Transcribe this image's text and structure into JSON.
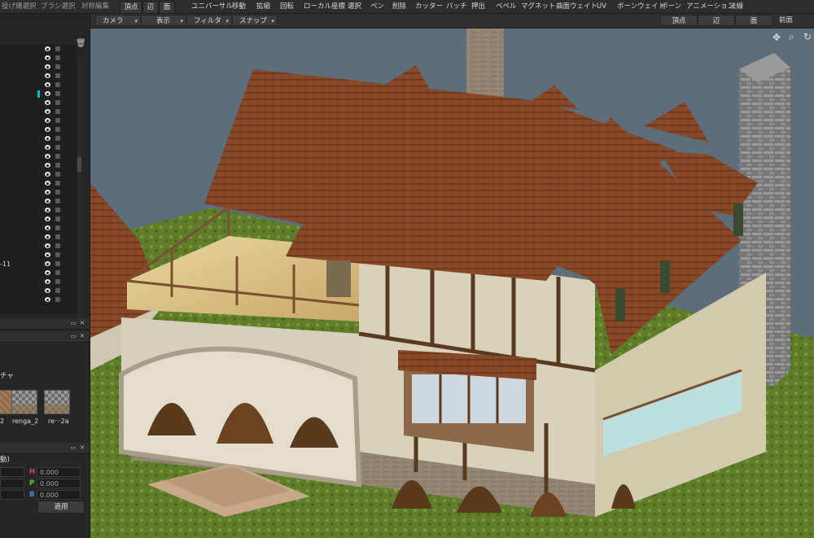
{
  "topbar": {
    "left_items": [
      "投げ縄選択",
      "ブラシ選択",
      "対称編集"
    ],
    "mode_buttons": [
      "頂点",
      "辺",
      "面"
    ],
    "menu_items": [
      "ユニバーサル",
      "移動",
      "拡縮",
      "回転",
      "ローカル座標",
      "選択",
      "ペン",
      "削除",
      "カッター",
      "パッチ",
      "押出",
      "ベベル",
      "マグネット",
      "曲面ウェイト",
      "UV",
      "ボーンウェイト",
      "ボーン",
      "アニメーション",
      "法線"
    ]
  },
  "toolbar2": {
    "dropdowns": [
      "カメラ",
      "表示",
      "フィルタ",
      "スナップ"
    ],
    "right_buttons": [
      "頂点",
      "辺",
      "面"
    ],
    "view_label": "前面"
  },
  "layers": {
    "row_label": "-11"
  },
  "material_panel": {
    "label_partial": "チャ",
    "swatches": [
      {
        "label": "2",
        "kind": "brick"
      },
      {
        "label": "renga_2",
        "kind": "checker"
      },
      {
        "label": "re···2a",
        "kind": "checker"
      }
    ]
  },
  "hsb_panel": {
    "label_partial": "動)",
    "fields": [
      {
        "label": "H",
        "value": "0.000"
      },
      {
        "label": "P",
        "value": "0.000"
      },
      {
        "label": "B",
        "value": "0.000"
      }
    ],
    "apply_label": "適用"
  },
  "viewport": {
    "nav_icons": [
      "move-icon",
      "zoom-icon",
      "rotate-icon"
    ],
    "colors": {
      "sky": "#5c6e7b",
      "grass": "#6a8a2e",
      "roof": "#8a4a2a",
      "wall": "#d8d0b8",
      "timber": "#5a3a1e",
      "stone": "#8a8a8a"
    }
  }
}
